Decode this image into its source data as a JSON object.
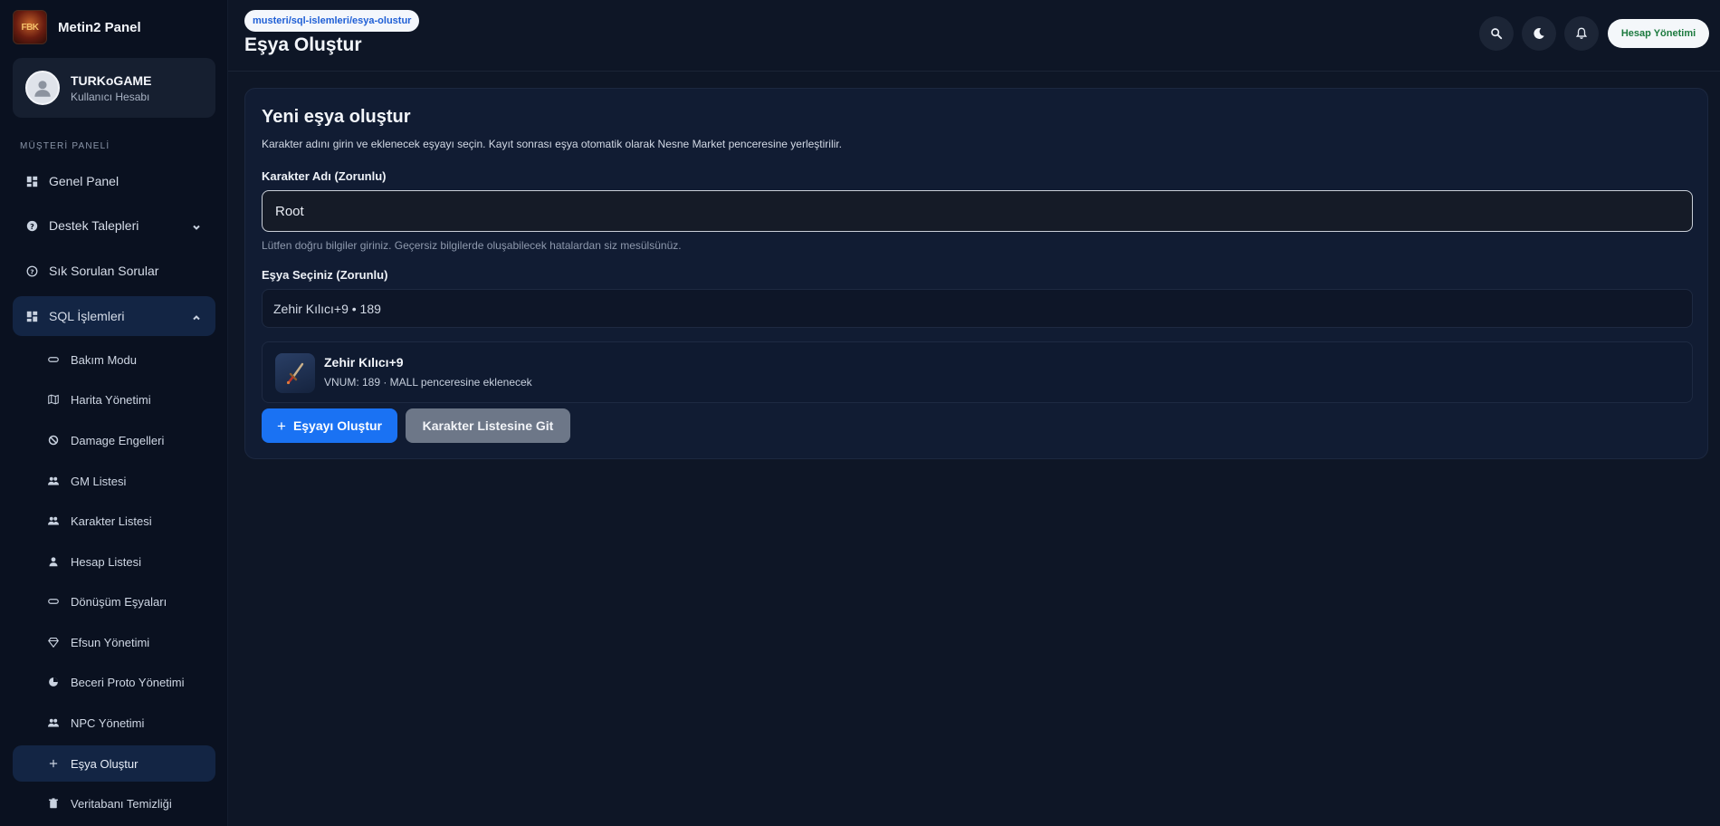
{
  "brand": {
    "name": "Metin2 Panel",
    "logo_text": "FBK"
  },
  "user": {
    "name": "TURKoGAME",
    "role": "Kullanıcı Hesabı"
  },
  "sidebar": {
    "section_label": "MÜŞTERİ PANELİ",
    "items": [
      {
        "label": "Genel Panel",
        "icon": "dashboard-icon"
      },
      {
        "label": "Destek Talepleri",
        "icon": "help-icon"
      },
      {
        "label": "Sık Sorulan Sorular",
        "icon": "question-icon"
      },
      {
        "label": "SQL İşlemleri",
        "icon": "dashboard-icon"
      }
    ],
    "sub_items": [
      {
        "label": "Bakım Modu",
        "icon": "pill-icon"
      },
      {
        "label": "Harita Yönetimi",
        "icon": "map-icon"
      },
      {
        "label": "Damage Engelleri",
        "icon": "block-icon"
      },
      {
        "label": "GM Listesi",
        "icon": "group-icon"
      },
      {
        "label": "Karakter Listesi",
        "icon": "group-icon"
      },
      {
        "label": "Hesap Listesi",
        "icon": "person-icon"
      },
      {
        "label": "Dönüşüm Eşyaları",
        "icon": "pill-icon"
      },
      {
        "label": "Efsun Yönetimi",
        "icon": "gem-icon"
      },
      {
        "label": "Beceri Proto Yönetimi",
        "icon": "skill-icon"
      },
      {
        "label": "NPC Yönetimi",
        "icon": "group-icon"
      },
      {
        "label": "Eşya Oluştur",
        "icon": "plus-icon"
      },
      {
        "label": "Veritabanı Temizliği",
        "icon": "trash-icon"
      }
    ]
  },
  "header": {
    "breadcrumb": "musteri/sql-islemleri/esya-olustur",
    "title": "Eşya Oluştur",
    "account_button": "Hesap Yönetimi"
  },
  "form": {
    "title": "Yeni eşya oluştur",
    "description": "Karakter adını girin ve eklenecek eşyayı seçin. Kayıt sonrası eşya otomatik olarak Nesne Market penceresine yerleştirilir.",
    "character_label": "Karakter Adı  (Zorunlu)",
    "character_value": "Root",
    "hint": "Lütfen doğru bilgiler giriniz. Geçersiz bilgilerde oluşabilecek hatalardan siz mesülsünüz.",
    "item_label": "Eşya Seçiniz  (Zorunlu)",
    "item_selected": "Zehir Kılıcı+9 • 189",
    "preview_name": "Zehir Kılıcı+9",
    "preview_meta": "VNUM: 189 · MALL penceresine eklenecek",
    "create_button": "Eşyayı Oluştur",
    "create_icon": "+",
    "list_button": "Karakter Listesine Git"
  },
  "colors": {
    "accent": "#1a72f3",
    "sidebar_active": "#132544",
    "account_text": "#1c7a3f"
  }
}
